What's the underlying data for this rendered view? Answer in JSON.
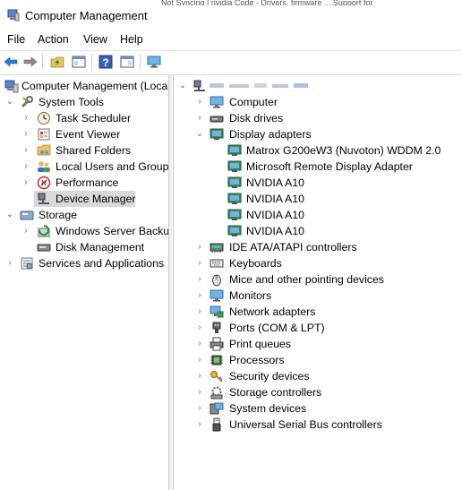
{
  "window": {
    "title": "Computer Management"
  },
  "background_tabs": "Not Syncing  |  nvidia Code - Drivers, firmware  ...  Support for",
  "menu": [
    "File",
    "Action",
    "View",
    "Help"
  ],
  "toolbar": {
    "icons": [
      "back-arrow-icon",
      "forward-arrow-icon",
      "up-folder-icon",
      "show-hide-tree-icon",
      "help-icon",
      "properties-icon",
      "monitor-icon"
    ]
  },
  "left_tree": {
    "root": "Computer Management (Local",
    "system_tools": "System Tools",
    "task_scheduler": "Task Scheduler",
    "event_viewer": "Event Viewer",
    "shared_folders": "Shared Folders",
    "local_users": "Local Users and Groups",
    "performance": "Performance",
    "device_manager": "Device Manager",
    "storage": "Storage",
    "wsb": "Windows Server Backup",
    "disk_management": "Disk Management",
    "services_apps": "Services and Applications"
  },
  "device_tree": {
    "root_label": "",
    "computer": "Computer",
    "disk_drives": "Disk drives",
    "display_adapters": "Display adapters",
    "adapters": [
      "Matrox G200eW3 (Nuvoton) WDDM 2.0",
      "Microsoft Remote Display Adapter",
      "NVIDIA A10",
      "NVIDIA A10",
      "NVIDIA A10",
      "NVIDIA A10"
    ],
    "categories": [
      "IDE ATA/ATAPI controllers",
      "Keyboards",
      "Mice and other pointing devices",
      "Monitors",
      "Network adapters",
      "Ports (COM & LPT)",
      "Print queues",
      "Processors",
      "Security devices",
      "Storage controllers",
      "System devices",
      "Universal Serial Bus controllers"
    ]
  }
}
